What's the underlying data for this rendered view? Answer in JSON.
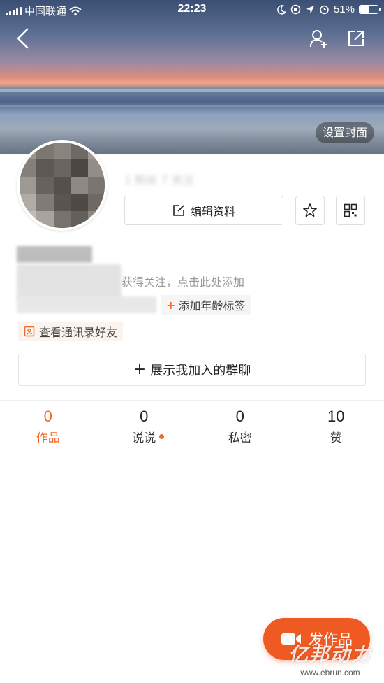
{
  "status_bar": {
    "carrier": "中国联通",
    "time": "22:23",
    "battery": "51%",
    "battery_level": 0.51
  },
  "cover": {
    "set_cover_label": "设置封面"
  },
  "profile": {
    "counts_text": "1 粉丝 7 关注",
    "edit_label": "编辑资料",
    "bio_visible_tail": "获得关注，点击此处添加",
    "add_tag_label": "添加年龄标签",
    "contacts_label": "查看通讯录好友",
    "groups_label": "展示我加入的群聊"
  },
  "tabs": [
    {
      "count": "0",
      "label": "作品",
      "active": true
    },
    {
      "count": "0",
      "label": "说说",
      "has_dot": true
    },
    {
      "count": "0",
      "label": "私密"
    },
    {
      "count": "10",
      "label": "赞"
    }
  ],
  "fab": {
    "label": "发作品"
  },
  "watermark": {
    "title": "亿邦动力",
    "url": "www.ebrun.com"
  },
  "colors": {
    "accent": "#ef6a2c",
    "fab": "#ef5a23"
  }
}
